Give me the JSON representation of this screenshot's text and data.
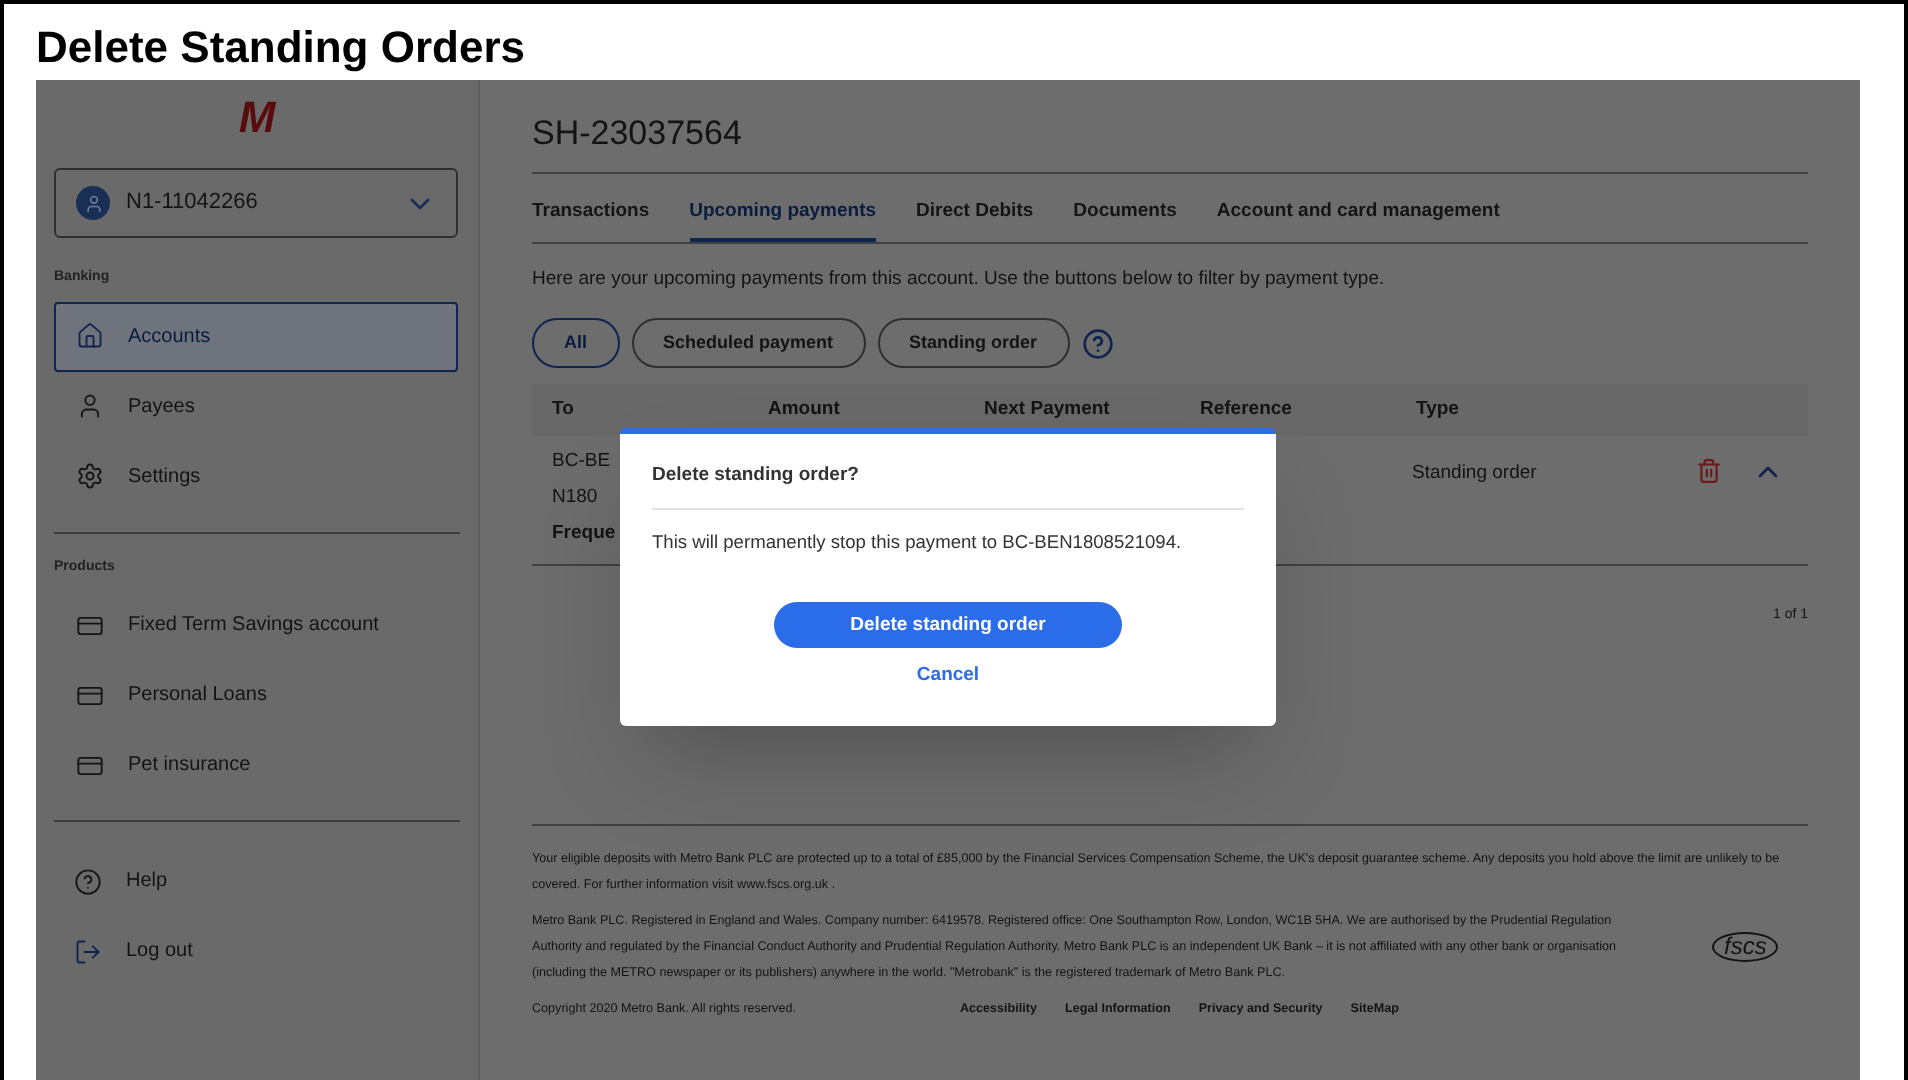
{
  "heading": "Delete Standing Orders",
  "logo": "M",
  "account_selector": {
    "value": "N1-11042266"
  },
  "sidebar": {
    "sections": [
      {
        "title": "Banking",
        "items": [
          {
            "label": "Accounts",
            "selected": true
          },
          {
            "label": "Payees",
            "selected": false
          },
          {
            "label": "Settings",
            "selected": false
          }
        ]
      },
      {
        "title": "Products",
        "items": [
          {
            "label": "Fixed Term Savings account",
            "selected": false
          },
          {
            "label": "Personal Loans",
            "selected": false
          },
          {
            "label": "Pet insurance",
            "selected": false
          }
        ]
      }
    ],
    "bottom_items": [
      {
        "label": "Help"
      },
      {
        "label": "Log out"
      }
    ]
  },
  "account_title": "SH-23037564",
  "tabs": [
    {
      "label": "Transactions",
      "selected": false
    },
    {
      "label": "Upcoming payments",
      "selected": true
    },
    {
      "label": "Direct Debits",
      "selected": false
    },
    {
      "label": "Documents",
      "selected": false
    },
    {
      "label": "Account and card management",
      "selected": false
    }
  ],
  "description": "Here are your upcoming payments from this account. Use the buttons below to filter by payment type.",
  "filters": [
    {
      "label": "All",
      "selected": true
    },
    {
      "label": "Scheduled payment",
      "selected": false
    },
    {
      "label": "Standing order",
      "selected": false
    }
  ],
  "table": {
    "columns": [
      "To",
      "Amount",
      "Next Payment",
      "Reference",
      "Type"
    ],
    "rows": [
      {
        "to": "BC-BEN180",
        "type": "Standing order",
        "expanded": true,
        "detail_label": "Freque"
      }
    ]
  },
  "pagination": "1 of 1",
  "footer": {
    "paragraphs": [
      "Your eligible deposits with Metro Bank PLC are protected up to a total of £85,000 by the Financial Services Compensation Scheme, the UK's deposit guarantee scheme. Any deposits you hold above the limit are unlikely to be covered. For further information visit www.fscs.org.uk .",
      "Metro Bank PLC. Registered in England and Wales. Company number: 6419578. Registered office: One Southampton Row, London, WC1B 5HA. We are authorised by the Prudential Regulation Authority and regulated by the Financial Conduct Authority and Prudential Regulation Authority. Metro Bank PLC is an independent UK Bank – it is not affiliated with any other bank or organisation (including the METRO newspaper or its publishers) anywhere in the world. \"Metrobank\" is the registered trademark of Metro Bank PLC."
    ],
    "copyright": "Copyright 2020 Metro Bank. All rights reserved.",
    "links": [
      "Accessibility",
      "Legal Information",
      "Privacy and Security",
      "SiteMap"
    ],
    "badge": "fscs"
  },
  "dialog": {
    "title": "Delete standing order?",
    "message": "This will permanently stop this payment to BC-BEN1808521094.",
    "primary_button": "Delete standing order",
    "secondary_button": "Cancel"
  }
}
